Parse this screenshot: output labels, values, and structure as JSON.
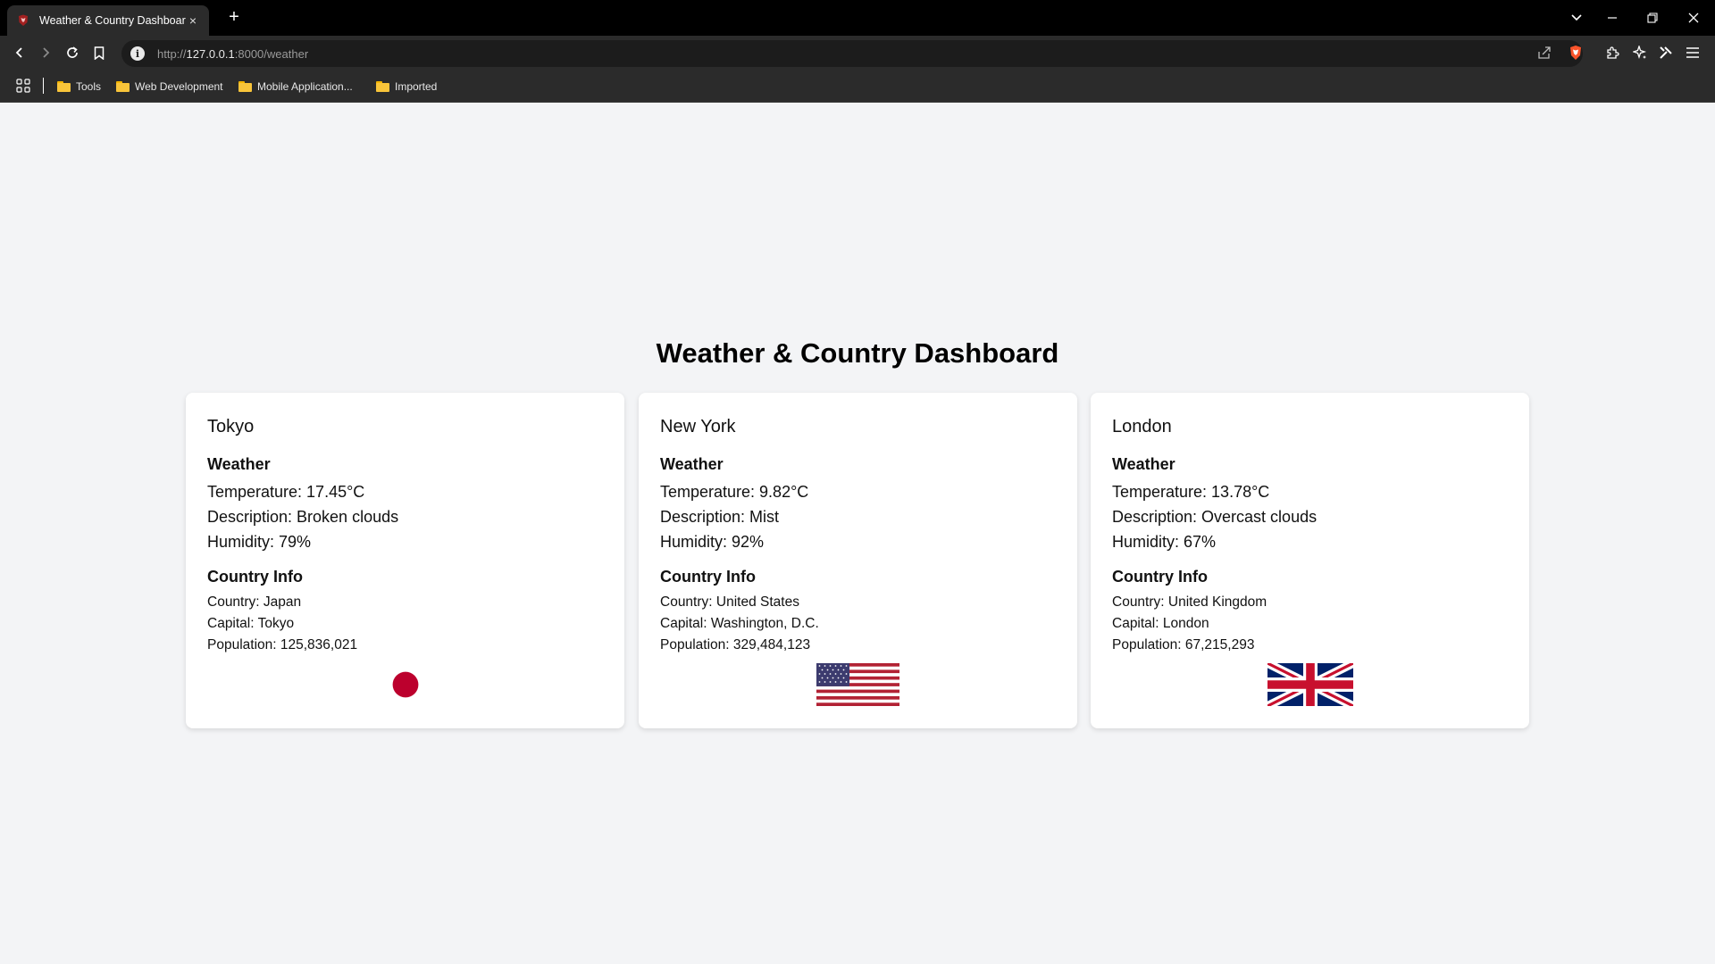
{
  "browser": {
    "tab_title": "Weather & Country Dashboard",
    "new_tab": "+",
    "tab_close": "×",
    "url_scheme": "http://",
    "url_host": "127.0.0.1",
    "url_rest": ":8000/weather",
    "bookmarks": [
      "Tools",
      "Web Development",
      "Mobile Application...",
      "Imported"
    ]
  },
  "page": {
    "title": "Weather & Country Dashboard",
    "cards": [
      {
        "city": "Tokyo",
        "weather_heading": "Weather",
        "temperature": "Temperature: 17.45°C",
        "description": "Description: Broken clouds",
        "humidity": "Humidity: 79%",
        "country_heading": "Country Info",
        "country": "Country: Japan",
        "capital": "Capital: Tokyo",
        "population": "Population: 125,836,021"
      },
      {
        "city": "New York",
        "weather_heading": "Weather",
        "temperature": "Temperature: 9.82°C",
        "description": "Description: Mist",
        "humidity": "Humidity: 92%",
        "country_heading": "Country Info",
        "country": "Country: United States",
        "capital": "Capital: Washington, D.C.",
        "population": "Population: 329,484,123"
      },
      {
        "city": "London",
        "weather_heading": "Weather",
        "temperature": "Temperature: 13.78°C",
        "description": "Description: Overcast clouds",
        "humidity": "Humidity: 67%",
        "country_heading": "Country Info",
        "country": "Country: United Kingdom",
        "capital": "Capital: London",
        "population": "Population: 67,215,293"
      }
    ]
  },
  "colors": {
    "page_bg": "#f3f4f6",
    "card_bg": "#ffffff",
    "japan_red": "#bc002d",
    "us_red": "#b22234",
    "us_blue": "#3c3b6e",
    "uk_blue": "#012169",
    "uk_red": "#c8102e"
  }
}
